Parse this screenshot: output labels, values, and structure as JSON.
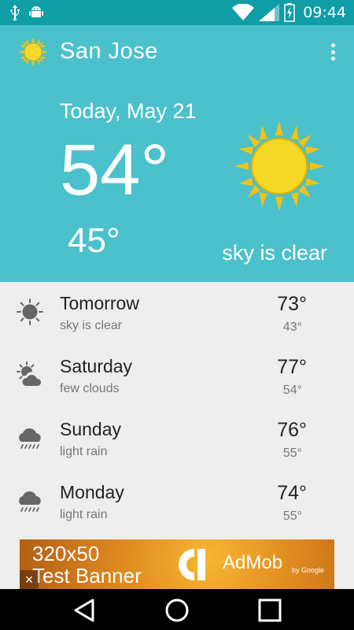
{
  "status_bar": {
    "time": "09:44",
    "icons": [
      "usb-icon",
      "android-debug-icon",
      "wifi-icon",
      "signal-icon",
      "battery-charging-icon"
    ]
  },
  "header": {
    "city": "San Jose",
    "date": "Today, May 21",
    "temp_high": "54°",
    "temp_low": "45°",
    "description": "sky is clear",
    "icon": "sun-icon",
    "background_color": "#4bc1cc"
  },
  "forecast": [
    {
      "day": "Tomorrow",
      "condition": "sky is clear",
      "high": "73°",
      "low": "43°",
      "icon": "clear-sky-icon"
    },
    {
      "day": "Saturday",
      "condition": "few clouds",
      "high": "77°",
      "low": "54°",
      "icon": "few-clouds-icon"
    },
    {
      "day": "Sunday",
      "condition": "light rain",
      "high": "76°",
      "low": "55°",
      "icon": "light-rain-icon"
    },
    {
      "day": "Monday",
      "condition": "light rain",
      "high": "74°",
      "low": "55°",
      "icon": "light-rain-icon"
    }
  ],
  "ad": {
    "line1": "320x50",
    "line2": "Test Banner",
    "brand": "AdMob",
    "by": "by Google",
    "close": "×"
  },
  "navbar": {
    "buttons": [
      "back-icon",
      "home-icon",
      "recents-icon"
    ]
  }
}
